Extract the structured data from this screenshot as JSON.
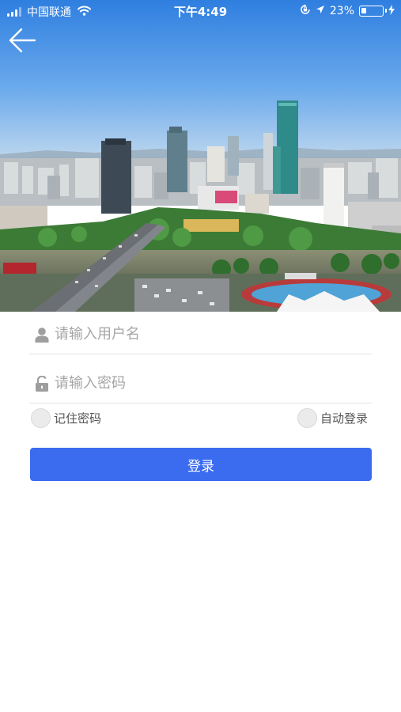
{
  "status_bar": {
    "carrier": "中国联通",
    "time": "下午4:49",
    "battery_percent": "23%",
    "battery_level": 0.23,
    "icons": [
      "signal-icon",
      "wifi-icon",
      "rotation-lock-icon",
      "location-icon",
      "battery-icon",
      "charging-icon"
    ]
  },
  "nav": {
    "back_icon": "arrow-left-icon"
  },
  "hero": {
    "image": "city-skyline-photo"
  },
  "login": {
    "username_placeholder": "请输入用户名",
    "password_placeholder": "请输入密码",
    "remember_password_label": "记住密码",
    "auto_login_label": "自动登录",
    "submit_label": "登录",
    "accent_color": "#3b6cf0"
  }
}
